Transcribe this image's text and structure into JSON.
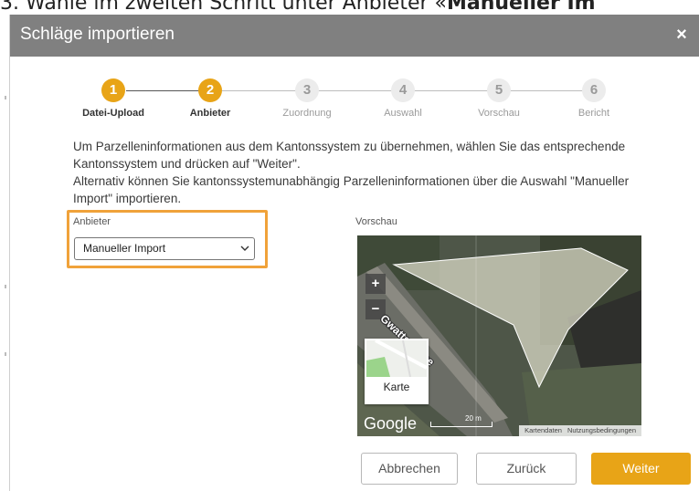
{
  "caption": {
    "prefix": "3. Wähle im zweiten Schritt unter Anbieter «",
    "bold": "Manueller Im"
  },
  "dialog": {
    "title": "Schläge importieren",
    "close_glyph": "×"
  },
  "stepper": {
    "current": 2,
    "steps": [
      {
        "number": "1",
        "label": "Datei-Upload",
        "state": "active"
      },
      {
        "number": "2",
        "label": "Anbieter",
        "state": "active"
      },
      {
        "number": "3",
        "label": "Zuordnung",
        "state": "inactive"
      },
      {
        "number": "4",
        "label": "Auswahl",
        "state": "inactive"
      },
      {
        "number": "5",
        "label": "Vorschau",
        "state": "inactive"
      },
      {
        "number": "6",
        "label": "Bericht",
        "state": "inactive"
      }
    ]
  },
  "intro": {
    "line1": "Um Parzelleninformationen aus dem Kantonssystem zu übernehmen, wählen Sie das entsprechende",
    "line2": "Kantonssystem und drücken auf \"Weiter\".",
    "line3": "Alternativ können Sie kantonssystemunabhängig Parzelleninformationen über die Auswahl \"Manueller",
    "line4": "Import\" importieren."
  },
  "provider": {
    "label": "Anbieter",
    "selected": "Manueller Import"
  },
  "preview": {
    "label": "Vorschau",
    "zoom_in": "+",
    "zoom_out": "−",
    "street_name": "Gwattstrasse",
    "map_type_label": "Karte",
    "logo": "Google",
    "scale_label": "20 m",
    "attribution_data": "Kartendaten",
    "attribution_terms": "Nutzungsbedingungen"
  },
  "buttons": {
    "cancel": "Abbrechen",
    "back": "Zurück",
    "next": "Weiter"
  },
  "colors": {
    "accent": "#e8a417",
    "highlight_border": "#f0a23a",
    "titlebar": "#808080"
  }
}
